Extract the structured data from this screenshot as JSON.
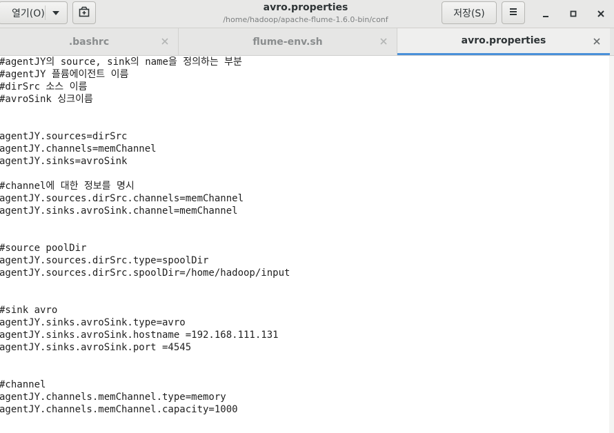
{
  "headerbar": {
    "open_label": "열기(O)",
    "save_label": "저장(S)",
    "title": "avro.properties",
    "subtitle": "/home/hadoop/apache-flume-1.6.0-bin/conf"
  },
  "icons": {
    "open_dropdown": "chevron-down-icon",
    "new_tab": "new-document-icon",
    "menu": "hamburger-menu-icon",
    "minimize": "minimize-icon",
    "maximize": "maximize-icon",
    "close": "close-icon"
  },
  "tabs": [
    {
      "label": ".bashrc",
      "active": false
    },
    {
      "label": "flume-env.sh",
      "active": false
    },
    {
      "label": "avro.properties",
      "active": true
    }
  ],
  "colors": {
    "active_tab_underline": "#4a90d9",
    "headerbar_bg": "#e8e8e7",
    "text": "#1f1f1f"
  },
  "editor": {
    "lines": [
      "#agentJY의 source, sink의 name을 정의하는 부분",
      "#agentJY 플륨에이전트 이름",
      "#dirSrc 소스 이름",
      "#avroSink 싱크이름",
      "",
      "",
      "agentJY.sources=dirSrc",
      "agentJY.channels=memChannel",
      "agentJY.sinks=avroSink",
      "",
      "#channel에 대한 정보를 명시",
      "agentJY.sources.dirSrc.channels=memChannel",
      "agentJY.sinks.avroSink.channel=memChannel",
      "",
      "",
      "#source poolDir",
      "agentJY.sources.dirSrc.type=spoolDir",
      "agentJY.sources.dirSrc.spoolDir=/home/hadoop/input",
      "",
      "",
      "#sink avro",
      "agentJY.sinks.avroSink.type=avro",
      "agentJY.sinks.avroSink.hostname =192.168.111.131",
      "agentJY.sinks.avroSink.port =4545",
      "",
      "",
      "#channel",
      "agentJY.channels.memChannel.type=memory",
      "agentJY.channels.memChannel.capacity=1000"
    ]
  }
}
